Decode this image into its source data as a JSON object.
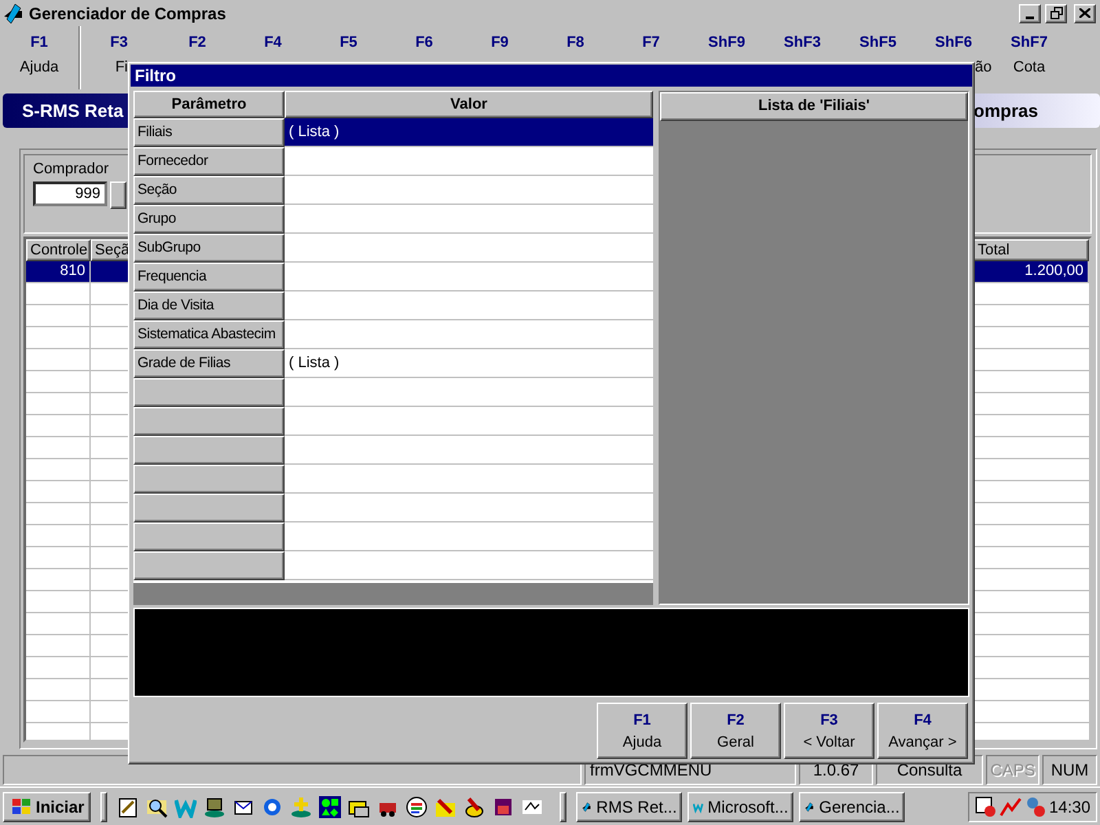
{
  "window": {
    "title": "Gerenciador de Compras"
  },
  "function_keys": [
    {
      "key": "F1",
      "label": "Ajuda"
    },
    {
      "key": "F3",
      "label": "Fi"
    },
    {
      "key": "F2"
    },
    {
      "key": "F4"
    },
    {
      "key": "F5"
    },
    {
      "key": "F6"
    },
    {
      "key": "F9"
    },
    {
      "key": "F8"
    },
    {
      "key": "F7"
    },
    {
      "key": "ShF9"
    },
    {
      "key": "ShF3"
    },
    {
      "key": "ShF5"
    },
    {
      "key": "ShF6",
      "label": "ão"
    },
    {
      "key": "ShF7",
      "label": "Cota"
    }
  ],
  "banner": {
    "title_left": "S-RMS Reta",
    "title_right": "ompras"
  },
  "buyer": {
    "label": "Comprador",
    "value": "999"
  },
  "main_table": {
    "columns": [
      "Controle",
      "Seçã",
      "Total"
    ],
    "rows": [
      {
        "controle": "810",
        "total": "1.200,00",
        "selected": true
      }
    ]
  },
  "filter_dialog": {
    "title": "Filtro",
    "columns": [
      "Parâmetro",
      "Valor"
    ],
    "rows": [
      {
        "parameter": "Filiais",
        "value": "( Lista )",
        "selected": true
      },
      {
        "parameter": "Fornecedor",
        "selected": false
      },
      {
        "parameter": "Seção",
        "selected": false
      },
      {
        "parameter": "Grupo",
        "selected": false
      },
      {
        "parameter": "SubGrupo",
        "selected": false
      },
      {
        "parameter": "Frequencia",
        "selected": false
      },
      {
        "parameter": "Dia de Visita",
        "selected": false
      },
      {
        "parameter": "Sistematica Abastecim",
        "selected": false
      },
      {
        "parameter": "Grade de Filias",
        "value": "( Lista )",
        "selected": false
      }
    ],
    "list_title": "Lista de 'Filiais'",
    "buttons": [
      {
        "key": "F1",
        "label": "Ajuda"
      },
      {
        "key": "F2",
        "label": "Geral"
      },
      {
        "key": "F3",
        "label": "< Voltar"
      },
      {
        "key": "F4",
        "label": "Avançar >"
      }
    ]
  },
  "status_bar": [
    {
      "text": "frmVGCMMENU",
      "disabled": false
    },
    {
      "text": "1.0.67",
      "disabled": false
    },
    {
      "text": "Consulta",
      "disabled": false
    },
    {
      "text": "CAPS",
      "disabled": true
    },
    {
      "text": "NUM",
      "disabled": false
    }
  ],
  "taskbar": {
    "start": "Iniciar",
    "tasks": [
      {
        "label": "RMS Ret...",
        "selected": false
      },
      {
        "label": "Microsoft...",
        "selected": false
      },
      {
        "label": "Gerencia...",
        "selected": false
      }
    ],
    "clock": "14:30"
  }
}
